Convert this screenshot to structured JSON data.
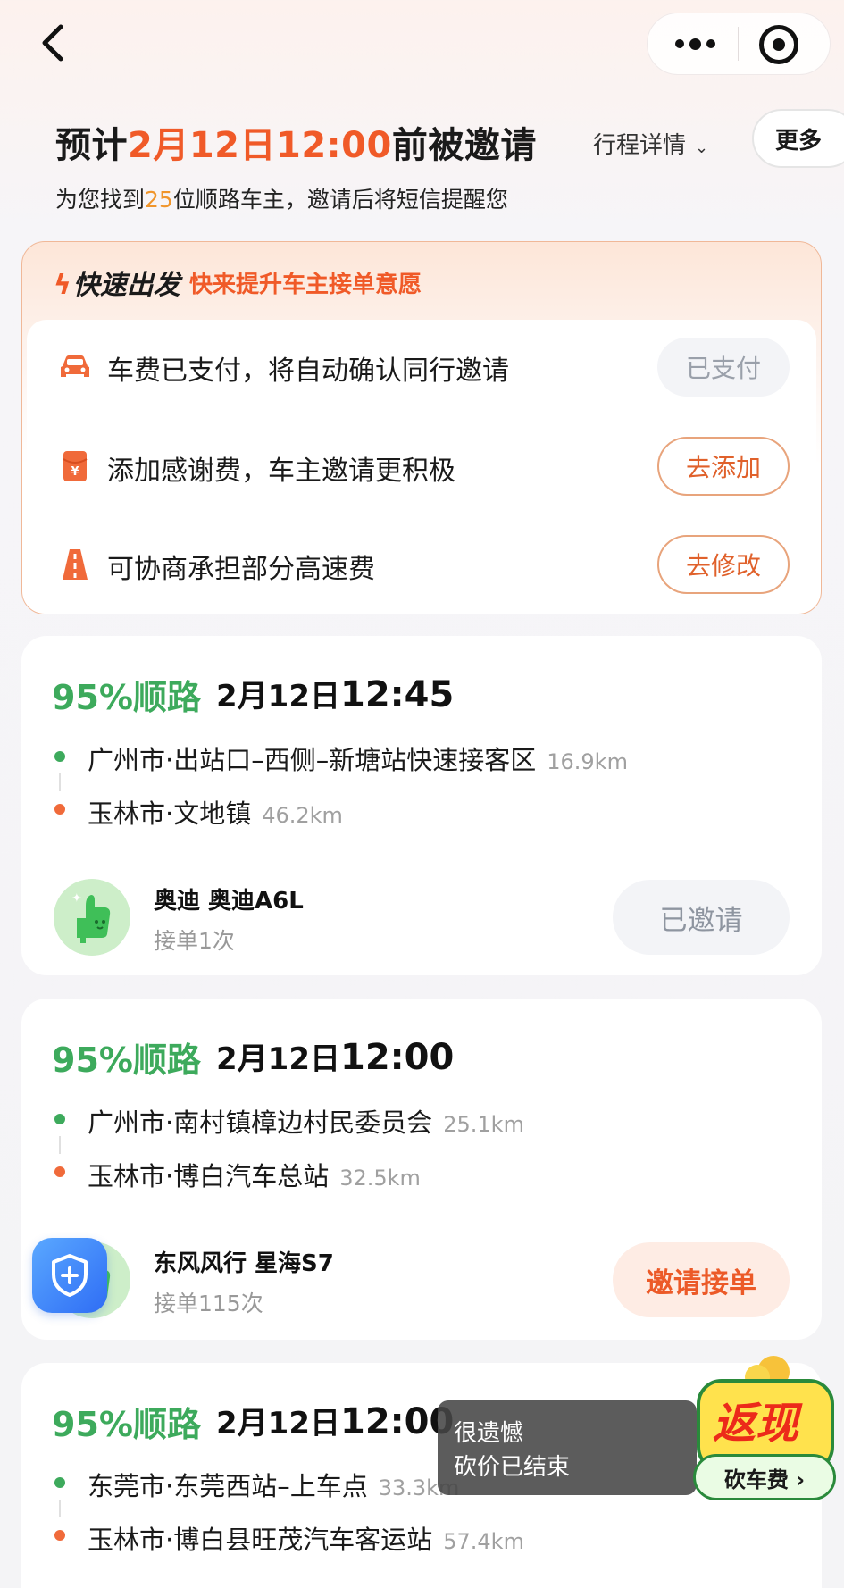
{
  "topbar": {
    "back_label": "‹"
  },
  "header": {
    "title_prefix": "预计",
    "title_time": "2月12日12:00",
    "title_suffix": "前被邀请",
    "sub_prefix": "为您找到",
    "sub_count": "25",
    "sub_suffix": "位顺路车主，邀请后将短信提醒您",
    "trip_detail": "行程详情",
    "more": "更多"
  },
  "quick": {
    "badge": "快速出发",
    "tip": "快来提升车主接单意愿",
    "rows": [
      {
        "text": "车费已支付，将自动确认同行邀请",
        "button": "已支付",
        "icon": "car-icon"
      },
      {
        "text": "添加感谢费，车主邀请更积极",
        "button": "去添加",
        "icon": "red-envelope-icon"
      },
      {
        "text": "可协商承担部分高速费",
        "button": "去修改",
        "icon": "highway-icon"
      }
    ]
  },
  "trips": [
    {
      "match": "95%顺路",
      "date": "2月12日",
      "time": "12:45",
      "from": "广州市·出站口–西侧–新塘站快速接客区",
      "from_dist": "16.9km",
      "to": "玉林市·文地镇",
      "to_dist": "46.2km",
      "car": "奥迪 奥迪A6L",
      "orders": "接单1次",
      "button": "已邀请"
    },
    {
      "match": "95%顺路",
      "date": "2月12日",
      "time": "12:00",
      "from": "广州市·南村镇樟边村民委员会",
      "from_dist": "25.1km",
      "to": "玉林市·博白汽车总站",
      "to_dist": "32.5km",
      "car": "东风风行 星海S7",
      "orders": "接单115次",
      "button": "邀请接单"
    },
    {
      "match": "95%顺路",
      "date": "2月12日",
      "time": "12:00",
      "from": "东莞市·东莞西站–上车点",
      "from_dist": "33.3km",
      "to": "玉林市·博白县旺茂汽车客运站",
      "to_dist": "57.4km"
    }
  ],
  "toast": {
    "line1": "很遗憾",
    "line2": "砍价已结束"
  },
  "cashback": {
    "title": "返现",
    "button": "砍车费 ›"
  },
  "colors": {
    "accent": "#f05a28",
    "match_green": "#3daa5c",
    "count_orange": "#f0952b"
  }
}
